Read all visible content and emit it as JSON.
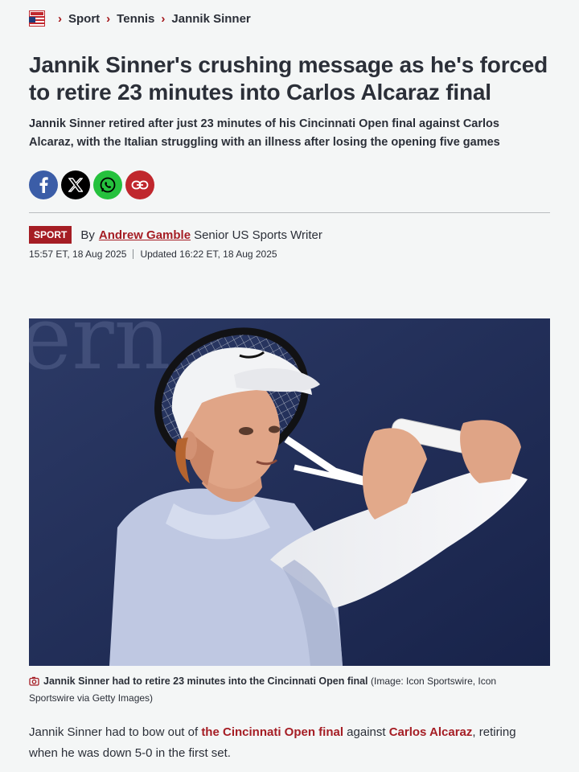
{
  "breadcrumb": {
    "logo": "mirror-us-logo",
    "items": [
      "Sport",
      "Tennis",
      "Jannik Sinner"
    ]
  },
  "article": {
    "headline": "Jannik Sinner's crushing message as he's forced to retire 23 minutes into Carlos Alcaraz final",
    "standfirst": "Jannik Sinner retired after just 23 minutes of his Cincinnati Open final against Carlos Alcaraz, with the Italian struggling with an illness after losing the opening five games",
    "section_tag": "SPORT",
    "by_label": "By",
    "author": "Andrew Gamble",
    "author_role": "Senior US Sports Writer",
    "published": "15:57 ET, 18 Aug 2025",
    "updated": "Updated 16:22 ET, 18 Aug 2025"
  },
  "share": {
    "icons": [
      "facebook-icon",
      "x-icon",
      "whatsapp-icon",
      "link-icon"
    ],
    "colors": {
      "facebook": "#3b5da7",
      "x": "#000000",
      "whatsapp": "#25c13d",
      "link": "#c0272d"
    }
  },
  "image": {
    "background_text": "ern",
    "caption": "Jannik Sinner had to retire 23 minutes into the Cincinnati Open final",
    "credit": "(Image: Icon Sportswire, Icon Sportswire via Getty Images)"
  },
  "body": {
    "p1_start": "Jannik Sinner had to bow out of ",
    "p1_link1": "the Cincinnati Open final",
    "p1_mid": " against ",
    "p1_link2": "Carlos Alcaraz",
    "p1_end": ", retiring when he was down 5-0 in the first set."
  },
  "colors": {
    "accent": "#a51d24",
    "text": "#2b2f38",
    "background": "#f4f6f6"
  }
}
